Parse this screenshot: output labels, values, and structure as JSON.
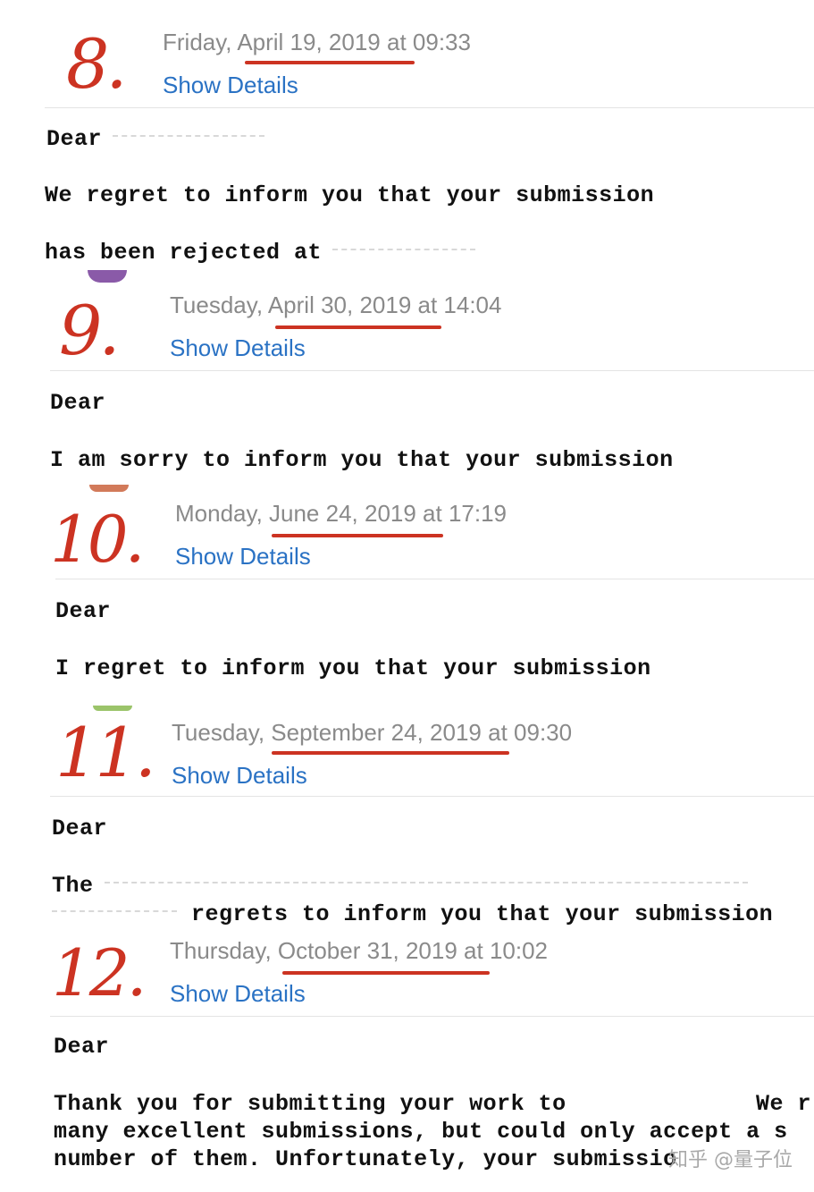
{
  "emails": [
    {
      "number": "8.",
      "date": "Friday, April 19, 2019 at 09:33",
      "details": "Show Details",
      "lines": [
        "Dear",
        "We regret to inform you that your submission",
        "has been rejected at"
      ]
    },
    {
      "number": "9.",
      "date": "Tuesday, April 30, 2019 at 14:04",
      "details": "Show Details",
      "lines": [
        "Dear",
        "I am sorry to inform you that your submission"
      ]
    },
    {
      "number": "10.",
      "date": "Monday, June 24, 2019 at 17:19",
      "details": "Show Details",
      "lines": [
        "Dear",
        "I regret to inform you that your submission"
      ]
    },
    {
      "number": "11.",
      "date": "Tuesday, September 24, 2019 at 09:30",
      "details": "Show Details",
      "lines": [
        "Dear",
        "The",
        "regrets to inform you that your submission"
      ]
    },
    {
      "number": "12.",
      "date": "Thursday, October 31, 2019 at 10:02",
      "details": "Show Details",
      "lines": [
        "Dear",
        "Thank you for submitting your work to",
        "We r",
        "many excellent submissions, but could only accept a s",
        "number of them. Unfortunately, your submissio"
      ]
    }
  ],
  "watermark": "知乎 @量子位",
  "colors": {
    "accent": "#cc3322",
    "link": "#2a72c4",
    "date": "#8a8a8a"
  }
}
